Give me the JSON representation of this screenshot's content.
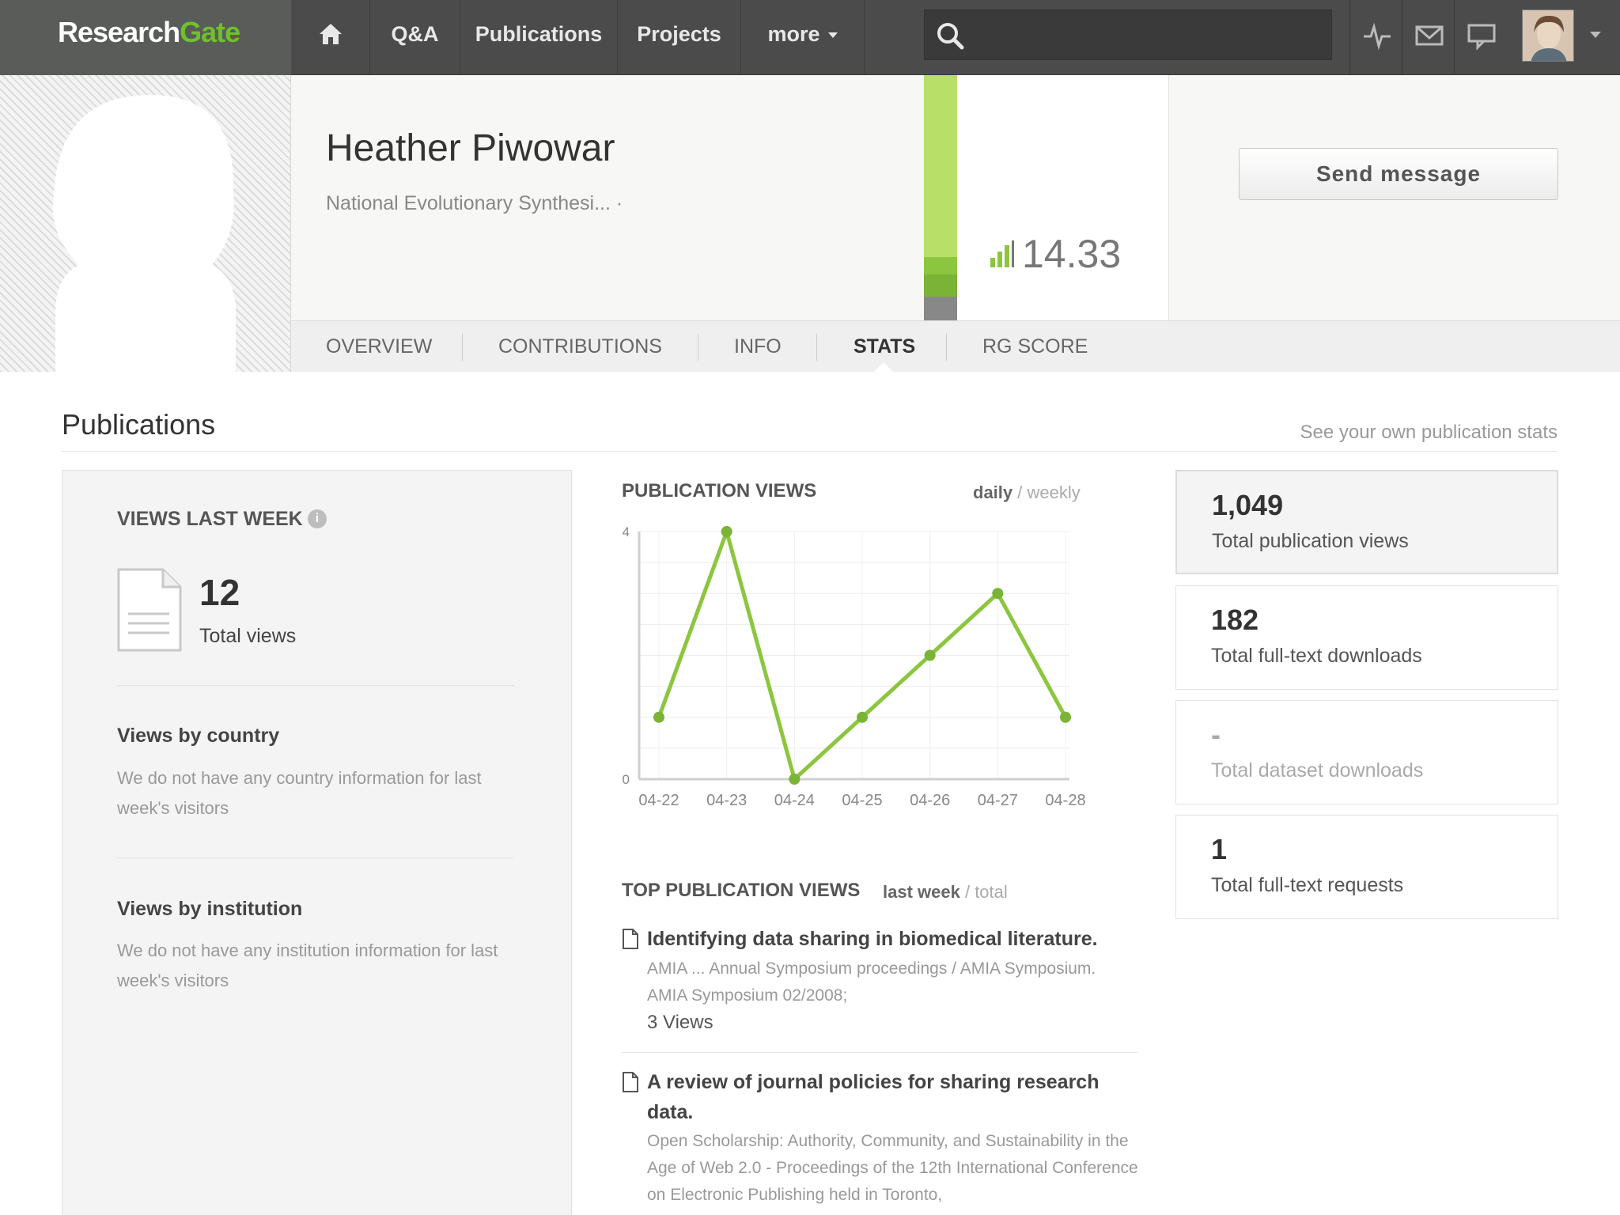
{
  "nav": {
    "logo_research": "Research",
    "logo_gate": "Gate",
    "items": [
      "Q&A",
      "Publications",
      "Projects",
      "more"
    ]
  },
  "profile": {
    "name": "Heather Piwowar",
    "institution": "National Evolutionary Synthesi... ·",
    "rg_score": "14.33",
    "send_message": "Send message"
  },
  "tabs": [
    "OVERVIEW",
    "CONTRIBUTIONS",
    "INFO",
    "STATS",
    "RG SCORE"
  ],
  "active_tab": "STATS",
  "section": {
    "title": "Publications",
    "own_stats_link": "See your own publication stats"
  },
  "views_last_week": {
    "title": "VIEWS LAST WEEK",
    "total": "12",
    "total_label": "Total views",
    "by_country_title": "Views by country",
    "by_country_text": "We do not have any country information for last week's visitors",
    "by_institution_title": "Views by institution",
    "by_institution_text": "We do not have any institution information for last week's visitors"
  },
  "chart_data": {
    "type": "line",
    "title": "PUBLICATION VIEWS",
    "toggle_active": "daily",
    "toggle_sep": " / ",
    "toggle_inactive": "weekly",
    "categories": [
      "04-22",
      "04-23",
      "04-24",
      "04-25",
      "04-26",
      "04-27",
      "04-28"
    ],
    "series": [
      {
        "values": [
          1,
          4,
          0,
          1,
          2,
          3,
          1
        ]
      }
    ],
    "ylim": [
      0,
      4
    ],
    "ytick_labels": [
      "0",
      "4"
    ],
    "grid": true,
    "color": "#8cc63f"
  },
  "top_pubs": {
    "title": "TOP PUBLICATION VIEWS",
    "toggle_active": "last week",
    "toggle_sep": " / ",
    "toggle_inactive": "total",
    "items": [
      {
        "title": "Identifying data sharing in biomedical literature.",
        "meta_1": "AMIA ... Annual Symposium proceedings / AMIA Symposium.",
        "meta_2": "AMIA Symposium 02/2008;",
        "views": "3 Views"
      },
      {
        "title": "A review of journal policies for sharing research data.",
        "meta": "Open Scholarship: Authority, Community, and Sustainability in the Age of Web 2.0 - Proceedings of the 12th International Conference on Electronic Publishing held in Toronto,"
      }
    ]
  },
  "stats": [
    {
      "value": "1,049",
      "label": "Total publication views"
    },
    {
      "value": "182",
      "label": "Total full-text downloads"
    },
    {
      "value": "-",
      "label": "Total dataset downloads"
    },
    {
      "value": "1",
      "label": "Total full-text requests"
    }
  ]
}
